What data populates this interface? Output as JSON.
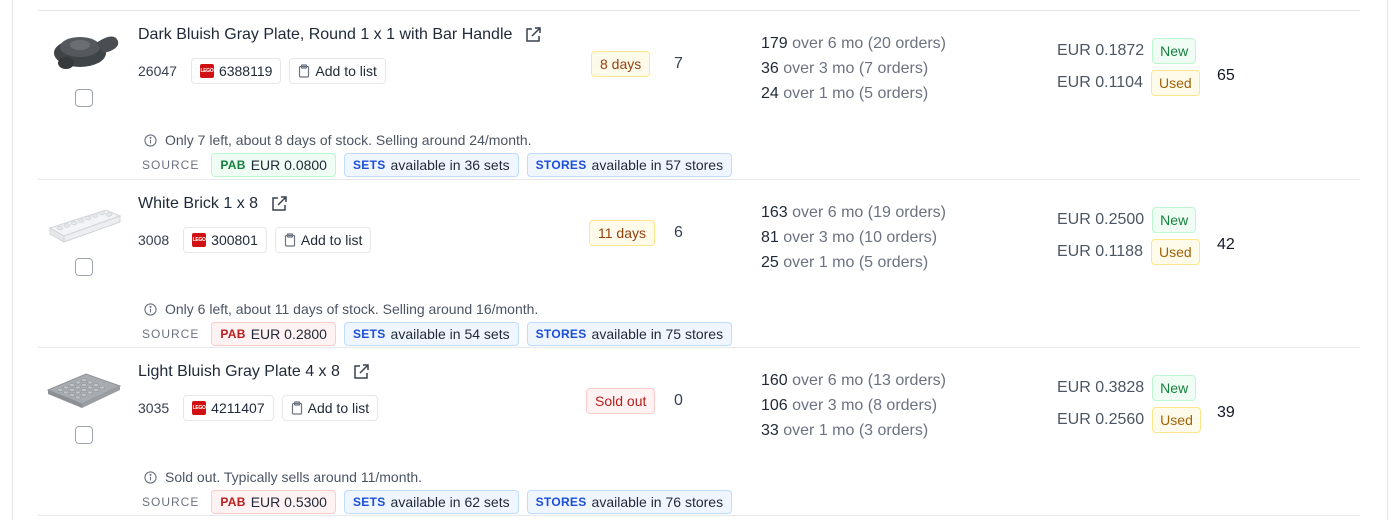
{
  "parts": [
    {
      "name": "Dark Bluish Gray Plate, Round 1 x 1 with Bar Handle",
      "part_id": "26047",
      "element_id": "6388119",
      "add_to_list": "Add to list",
      "stock_badge": "8 days",
      "stock_qty": "7",
      "sales": [
        {
          "num": "179",
          "desc": "over 6 mo (20 orders)"
        },
        {
          "num": "36",
          "desc": "over 3 mo (7 orders)"
        },
        {
          "num": "24",
          "desc": "over 1 mo (5 orders)"
        }
      ],
      "price_new": "EUR 0.1872",
      "label_new": "New",
      "price_used": "EUR 0.1104",
      "label_used": "Used",
      "total": "65",
      "info": "Only 7 left, about 8 days of stock. Selling around 24/month.",
      "source_label": "SOURCE",
      "pab_tag": "PAB",
      "pab_price": "EUR 0.0800",
      "sets_tag": "SETS",
      "sets_text": "available in 36 sets",
      "stores_tag": "STORES",
      "stores_text": "available in 57 stores"
    },
    {
      "name": "White Brick 1 x 8",
      "part_id": "3008",
      "element_id": "300801",
      "add_to_list": "Add to list",
      "stock_badge": "11 days",
      "stock_qty": "6",
      "sales": [
        {
          "num": "163",
          "desc": "over 6 mo (19 orders)"
        },
        {
          "num": "81",
          "desc": "over 3 mo (10 orders)"
        },
        {
          "num": "25",
          "desc": "over 1 mo (5 orders)"
        }
      ],
      "price_new": "EUR 0.2500",
      "label_new": "New",
      "price_used": "EUR 0.1188",
      "label_used": "Used",
      "total": "42",
      "info": "Only 6 left, about 11 days of stock. Selling around 16/month.",
      "source_label": "SOURCE",
      "pab_tag": "PAB",
      "pab_price": "EUR 0.2800",
      "sets_tag": "SETS",
      "sets_text": "available in 54 sets",
      "stores_tag": "STORES",
      "stores_text": "available in 75 stores"
    },
    {
      "name": "Light Bluish Gray Plate 4 x 8",
      "part_id": "3035",
      "element_id": "4211407",
      "add_to_list": "Add to list",
      "stock_badge": "Sold out",
      "stock_qty": "0",
      "sales": [
        {
          "num": "160",
          "desc": "over 6 mo (13 orders)"
        },
        {
          "num": "106",
          "desc": "over 3 mo (8 orders)"
        },
        {
          "num": "33",
          "desc": "over 1 mo (3 orders)"
        }
      ],
      "price_new": "EUR 0.3828",
      "label_new": "New",
      "price_used": "EUR 0.2560",
      "label_used": "Used",
      "total": "39",
      "info": "Sold out. Typically sells around 11/month.",
      "source_label": "SOURCE",
      "pab_tag": "PAB",
      "pab_price": "EUR 0.5300",
      "sets_tag": "SETS",
      "sets_text": "available in 62 sets",
      "stores_tag": "STORES",
      "stores_text": "available in 76 stores"
    }
  ],
  "colors": {
    "pab_green": "#15803d",
    "pab_red": "#b91c1c",
    "source_blue": "#1d4ed8",
    "badge_amber": "#92400e"
  },
  "icons": {
    "external_link": "external-link-icon",
    "lego_logo": "lego-logo-icon",
    "clipboard": "clipboard-icon",
    "info": "info-icon"
  }
}
